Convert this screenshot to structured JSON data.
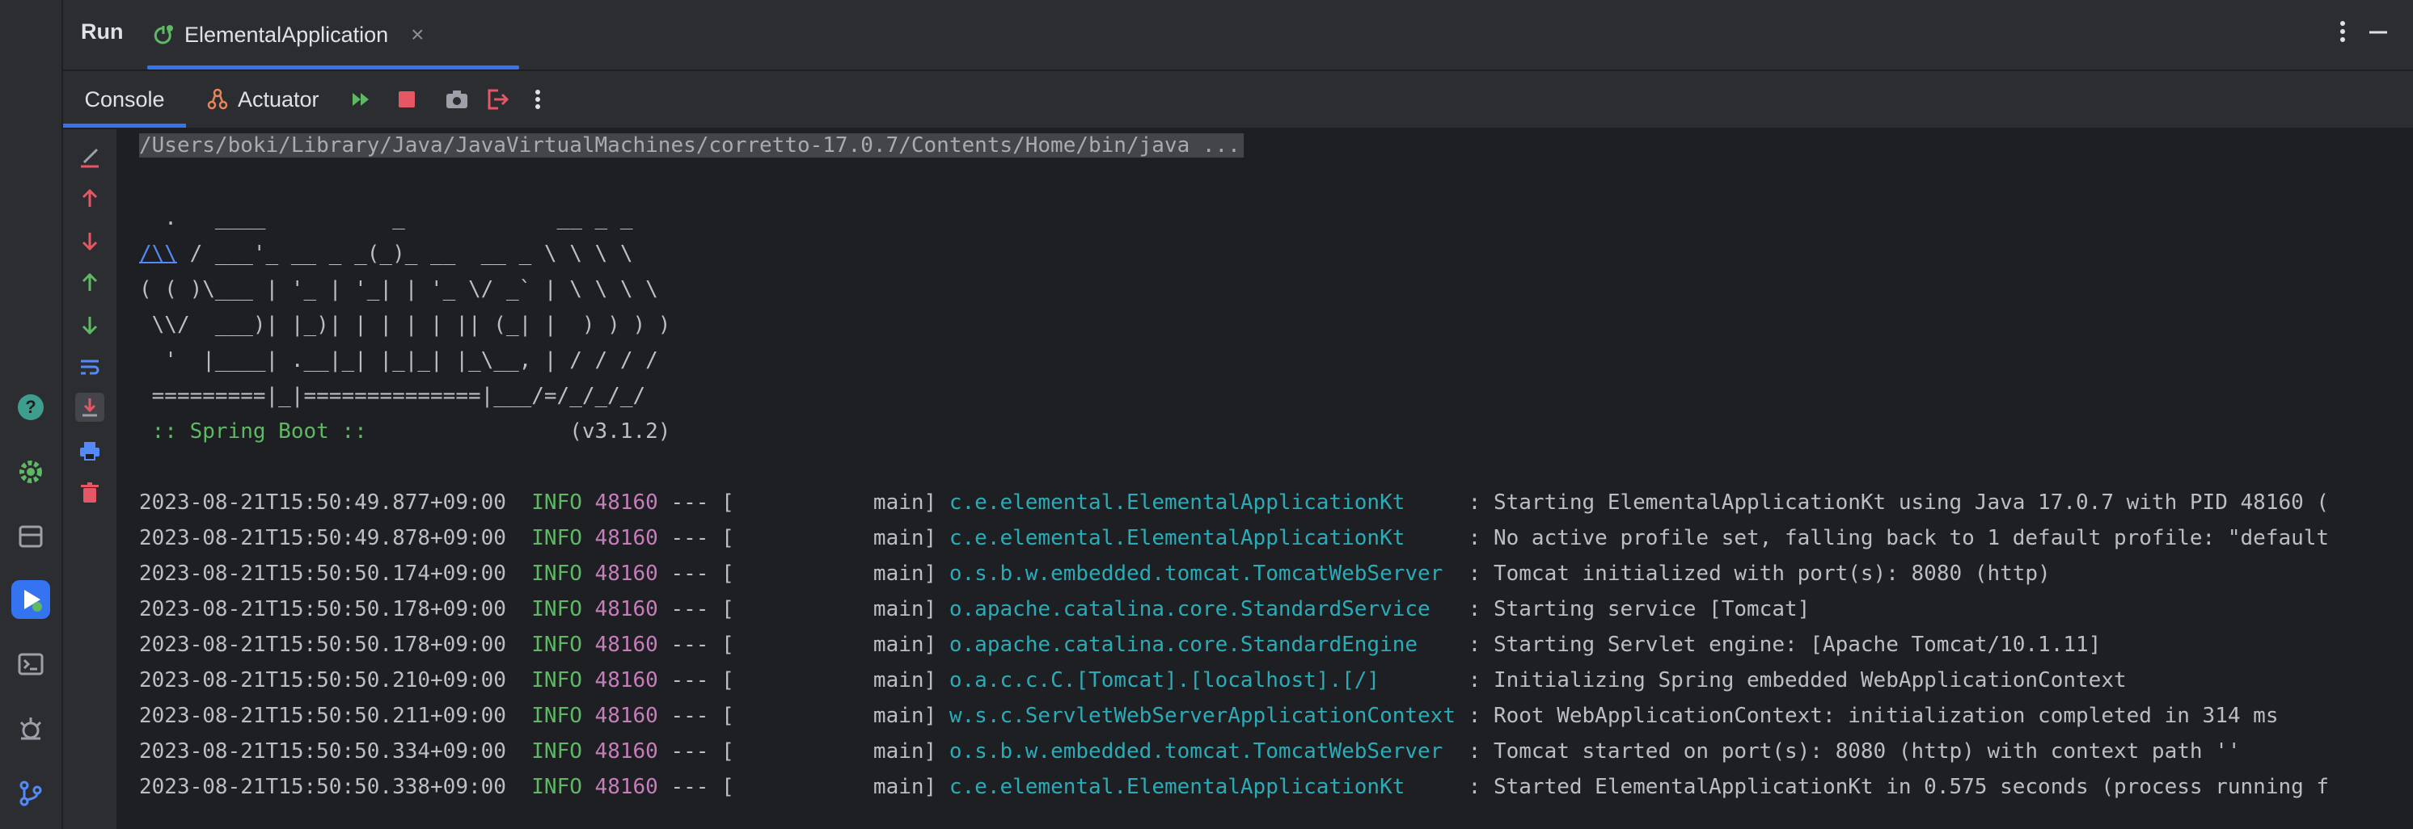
{
  "window": {
    "run_title": "Run",
    "tab_label": "ElementalApplication"
  },
  "toolbar": {
    "console_tab": "Console",
    "actuator_tab": "Actuator"
  },
  "console": {
    "command": "/Users/boki/Library/Java/JavaVirtualMachines/corretto-17.0.7/Contents/Home/bin/java ...",
    "banner": [
      "  .   ____          _            __ _ _",
      " /\\\\ / ___'_ __ _ _(_)_ __  __ _ \\ \\ \\ \\",
      "( ( )\\___ | '_ | '_| | '_ \\/ _` | \\ \\ \\ \\",
      " \\\\/  ___)| |_)| | | | | || (_| |  ) ) ) )",
      "  '  |____| .__|_| |_|_| |_\\__, | / / / /",
      " =========|_|==============|___/=/_/_/_/"
    ],
    "banner_link": "/\\\\",
    "banner_line1_rest": " / ___'_ __ _ _(_)_ __  __ _ \\ \\ \\ \\",
    "spring_label": " :: Spring Boot :: ",
    "spring_version": "               (v3.1.2)",
    "logs": [
      {
        "ts": "2023-08-21T15:50:49.877+09:00",
        "level": "INFO",
        "pid": "48160",
        "sep": " --- [           main] ",
        "logger": "c.e.elemental.ElementalApplicationKt    ",
        "msg": " : Starting ElementalApplicationKt using Java 17.0.7 with PID 48160 ("
      },
      {
        "ts": "2023-08-21T15:50:49.878+09:00",
        "level": "INFO",
        "pid": "48160",
        "sep": " --- [           main] ",
        "logger": "c.e.elemental.ElementalApplicationKt    ",
        "msg": " : No active profile set, falling back to 1 default profile: \"default"
      },
      {
        "ts": "2023-08-21T15:50:50.174+09:00",
        "level": "INFO",
        "pid": "48160",
        "sep": " --- [           main] ",
        "logger": "o.s.b.w.embedded.tomcat.TomcatWebServer ",
        "msg": " : Tomcat initialized with port(s): 8080 (http)"
      },
      {
        "ts": "2023-08-21T15:50:50.178+09:00",
        "level": "INFO",
        "pid": "48160",
        "sep": " --- [           main] ",
        "logger": "o.apache.catalina.core.StandardService  ",
        "msg": " : Starting service [Tomcat]"
      },
      {
        "ts": "2023-08-21T15:50:50.178+09:00",
        "level": "INFO",
        "pid": "48160",
        "sep": " --- [           main] ",
        "logger": "o.apache.catalina.core.StandardEngine   ",
        "msg": " : Starting Servlet engine: [Apache Tomcat/10.1.11]"
      },
      {
        "ts": "2023-08-21T15:50:50.210+09:00",
        "level": "INFO",
        "pid": "48160",
        "sep": " --- [           main] ",
        "logger": "o.a.c.c.C.[Tomcat].[localhost].[/]      ",
        "msg": " : Initializing Spring embedded WebApplicationContext"
      },
      {
        "ts": "2023-08-21T15:50:50.211+09:00",
        "level": "INFO",
        "pid": "48160",
        "sep": " --- [           main] ",
        "logger": "w.s.c.ServletWebServerApplicationContext",
        "msg": " : Root WebApplicationContext: initialization completed in 314 ms"
      },
      {
        "ts": "2023-08-21T15:50:50.334+09:00",
        "level": "INFO",
        "pid": "48160",
        "sep": " --- [           main] ",
        "logger": "o.s.b.w.embedded.tomcat.TomcatWebServer ",
        "msg": " : Tomcat started on port(s): 8080 (http) with context path ''"
      },
      {
        "ts": "2023-08-21T15:50:50.338+09:00",
        "level": "INFO",
        "pid": "48160",
        "sep": " --- [           main] ",
        "logger": "c.e.elemental.ElementalApplicationKt    ",
        "msg": " : Started ElementalApplicationKt in 0.575 seconds (process running f"
      }
    ]
  },
  "colors": {
    "accent": "#3574f0",
    "info": "#5fb864",
    "pid": "#c77dbb",
    "logger": "#2aacb8",
    "stop": "#e55765"
  }
}
